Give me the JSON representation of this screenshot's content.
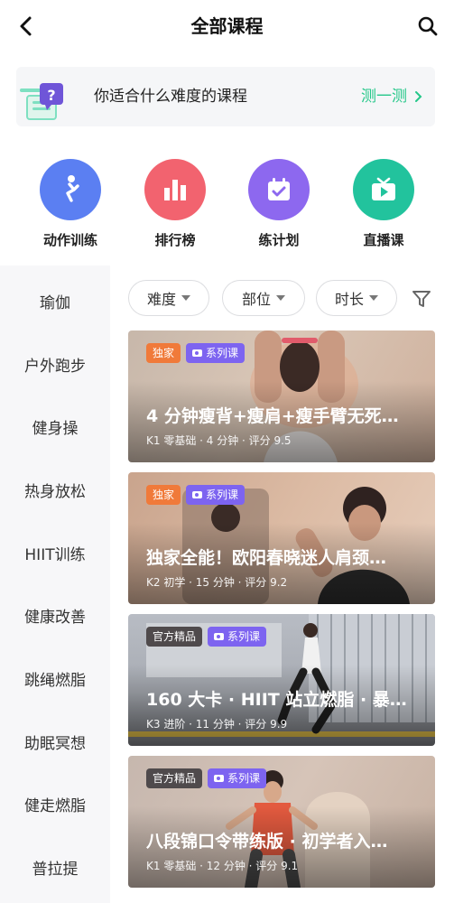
{
  "header": {
    "title": "全部课程",
    "back_icon": "back-arrow-icon",
    "search_icon": "search-icon"
  },
  "banner": {
    "text": "你适合什么难度的课程",
    "action": "测一测",
    "action_color": "#24c789",
    "icon": "question-chat-icon"
  },
  "quick": [
    {
      "label": "动作训练",
      "icon": "squat-figure-icon",
      "color": "#5b7ff2"
    },
    {
      "label": "排行榜",
      "icon": "bar-chart-icon",
      "color": "#f2636f"
    },
    {
      "label": "练计划",
      "icon": "calendar-check-icon",
      "color": "#8d68ef"
    },
    {
      "label": "直播课",
      "icon": "live-tv-icon",
      "color": "#22c39d"
    }
  ],
  "sidebar": {
    "items": [
      "瑜伽",
      "户外跑步",
      "健身操",
      "热身放松",
      "HIIT训练",
      "健康改善",
      "跳绳燃脂",
      "助眠冥想",
      "健走燃脂",
      "普拉提"
    ]
  },
  "filters": {
    "difficulty": "难度",
    "part": "部位",
    "duration": "时长",
    "filter_icon": "funnel-icon"
  },
  "courses": [
    {
      "badge1": "独家",
      "badge2": "系列课",
      "title": "4 分钟瘦背+瘦肩+瘦手臂无死…",
      "meta": "K1 零基础 · 4 分钟 · 评分 9.5"
    },
    {
      "badge1": "独家",
      "badge2": "系列课",
      "title": "独家全能！欧阳春晓迷人肩颈…",
      "meta": "K2 初学 · 15 分钟 · 评分 9.2"
    },
    {
      "badge1": "官方精品",
      "badge2": "系列课",
      "title": "160 大卡 · HIIT 站立燃脂 · 暴…",
      "meta": "K3 进阶 · 11 分钟 · 评分 9.9"
    },
    {
      "badge1": "官方精品",
      "badge2": "系列课",
      "title": "八段锦口令带练版 · 初学者入…",
      "meta": "K1 零基础 · 12 分钟 · 评分 9.1"
    }
  ]
}
